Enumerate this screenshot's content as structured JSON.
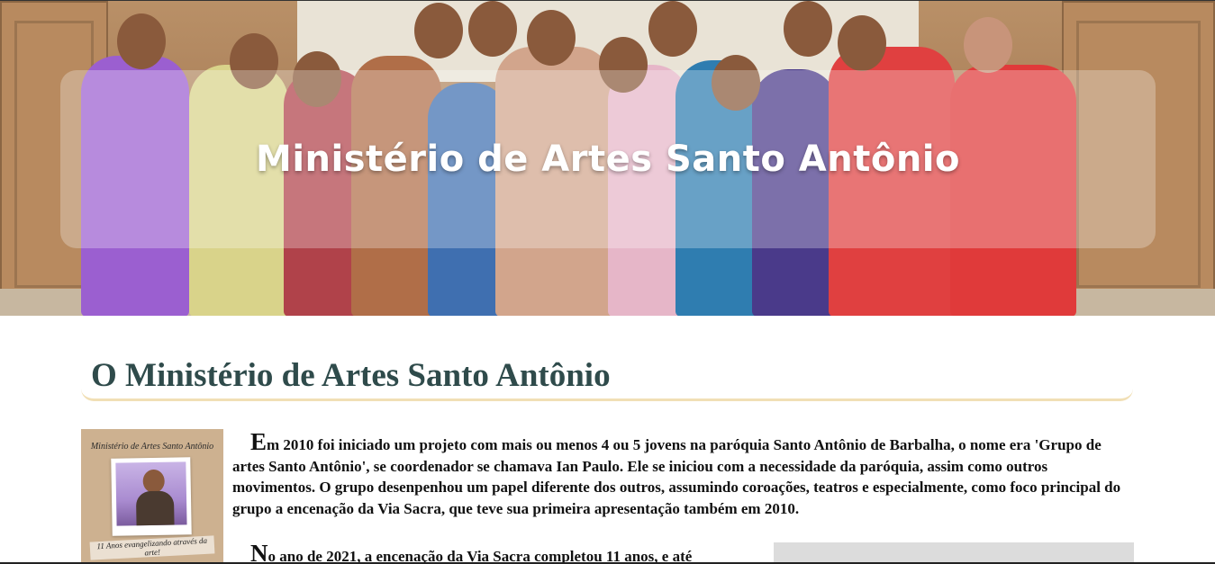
{
  "hero": {
    "title": "Ministério de Artes Santo Antônio"
  },
  "section": {
    "title": "O Ministério de Artes Santo Antônio"
  },
  "thumbnail": {
    "title": "Ministério de Artes Santo Antônio",
    "caption": "11 Anos evangelizando através da arte!"
  },
  "article": {
    "p1_dropcap": "E",
    "p1_text": "m 2010 foi iniciado um projeto com mais ou menos 4 ou 5 jovens na paróquia Santo Antônio de Barbalha, o nome era 'Grupo de artes Santo Antônio', se coordenador se chamava Ian Paulo. Ele se iniciou com a necessidade da paróquia, assim como outros movimentos. O grupo desenpenhou um papel diferente dos outros, assumindo coroações, teatros e especialmente, como foco principal do grupo a encenação da Via Sacra, que teve sua primeira apresentação também em 2010.",
    "p2_dropcap": "N",
    "p2_text": "o ano de 2021, a encenação da Via Sacra completou 11 anos, e até"
  },
  "colors": {
    "heading": "#2f4b4b",
    "rule": "#f1dfb5",
    "banner_text": "#ffffff"
  }
}
